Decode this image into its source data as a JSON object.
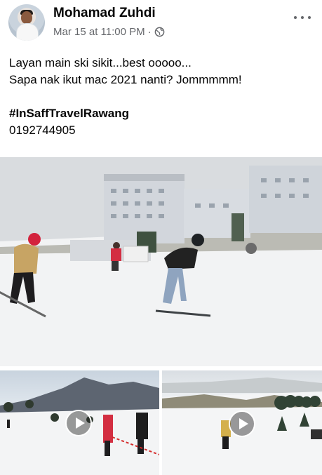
{
  "post": {
    "author": "Mohamad Zuhdi",
    "timestamp": "Mar 15 at 11:00 PM",
    "separator": "·",
    "privacy_icon": "globe-icon",
    "more_icon": "more-options-icon",
    "text_lines": [
      "Layan main ski sikit...best ooooo...",
      "Sapa nak ikut mac 2021 nanti? Jommmmm!"
    ],
    "hashtag": "#InSaffTravelRawang",
    "phone": "0192744905"
  },
  "media": {
    "main_photo": "ski-slope-photo",
    "videos": [
      {
        "name": "ski-video-1",
        "icon": "play-icon"
      },
      {
        "name": "ski-video-2",
        "icon": "play-icon"
      }
    ]
  },
  "colors": {
    "text": "#050505",
    "meta": "#65676b",
    "snow": "#f4f5f6",
    "sky": "#d5d8db"
  }
}
